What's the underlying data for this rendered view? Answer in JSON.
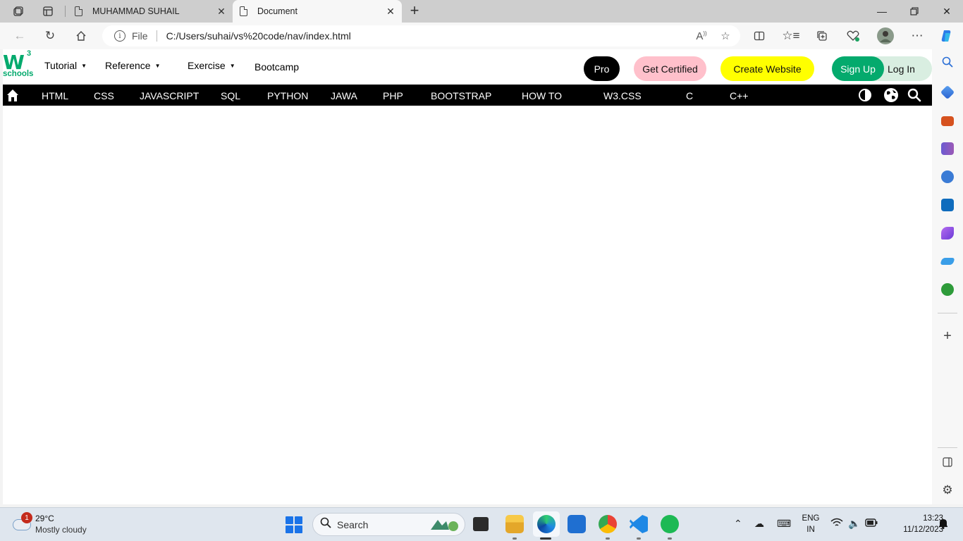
{
  "browser": {
    "tabs": [
      {
        "title": "MUHAMMAD SUHAIL",
        "active": false
      },
      {
        "title": "Document",
        "active": true
      }
    ],
    "address": {
      "scheme_label": "File",
      "url": "C:/Users/suhai/vs%20code/nav/index.html"
    }
  },
  "page": {
    "logo": {
      "main": "W",
      "superscript": "3",
      "sub": "schools",
      "color": "#04aa6d"
    },
    "top_menu": [
      {
        "label": "Tutorial"
      },
      {
        "label": "Reference"
      },
      {
        "label": "Exercise"
      },
      {
        "label": "Bootcamp"
      }
    ],
    "buttons": {
      "pro": "Pro",
      "get_certified": "Get Certified",
      "create_website": "Create Website",
      "sign_up": "Sign Up",
      "log_in": "Log In"
    },
    "nav_items": [
      "HTML",
      "CSS",
      "JAVASCRIPT",
      "SQL",
      "PYTHON",
      "JAWA",
      "PHP",
      "BOOTSTRAP",
      "HOW TO",
      "W3.CSS",
      "C",
      "C++"
    ],
    "colors": {
      "navbar": "#000000",
      "pro": "#000000",
      "certified": "#ffc0cb",
      "create": "#ffff00",
      "signup": "#04aa6d"
    }
  },
  "taskbar": {
    "weather": {
      "badge": "1",
      "temp": "29°C",
      "condition": "Mostly cloudy"
    },
    "search_label": "Search",
    "language": {
      "line1": "ENG",
      "line2": "IN"
    },
    "clock": {
      "time": "13:23",
      "date": "11/12/2023"
    }
  }
}
